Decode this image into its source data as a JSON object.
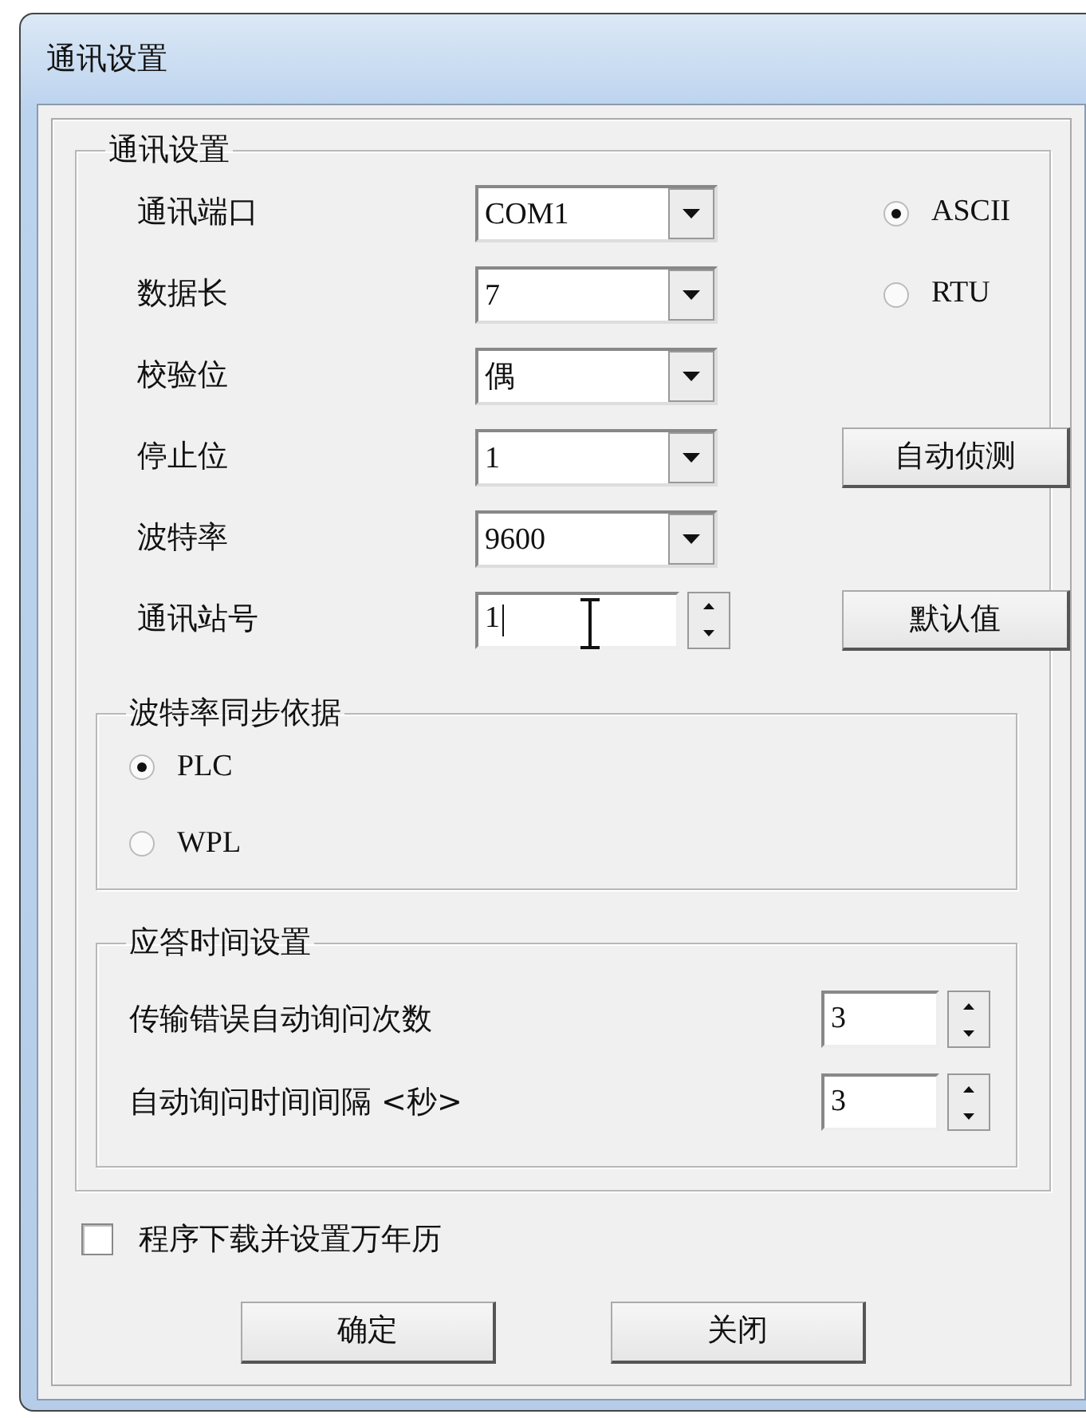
{
  "window": {
    "title": "通讯设置"
  },
  "group": {
    "title": "通讯设置",
    "fields": [
      {
        "kind": "combo",
        "label": "通讯端口",
        "value": "COM1"
      },
      {
        "kind": "combo",
        "label": "数据长",
        "value": "7"
      },
      {
        "kind": "combo",
        "label": "校验位",
        "value": "偶"
      },
      {
        "kind": "combo",
        "label": "停止位",
        "value": "1"
      },
      {
        "kind": "combo",
        "label": "波特率",
        "value": "9600"
      },
      {
        "kind": "spin",
        "label": "通讯站号",
        "value": "1"
      }
    ],
    "mode_options": [
      {
        "label": "ASCII",
        "selected": true
      },
      {
        "label": "RTU",
        "selected": false
      }
    ],
    "buttons": [
      "自动侦测",
      "默认值"
    ],
    "sync": {
      "title": "波特率同步依据",
      "options": [
        {
          "label": "PLC",
          "selected": true
        },
        {
          "label": "WPL",
          "selected": false
        }
      ]
    },
    "response": {
      "title": "应答时间设置",
      "fields": [
        {
          "label": "传输错误自动询问次数",
          "value": "3"
        },
        {
          "label": "自动询问时间间隔 <秒>",
          "value": "3"
        }
      ]
    }
  },
  "checkbox": {
    "label": "程序下载并设置万年历",
    "checked": false
  },
  "buttons": [
    "确定",
    "关闭"
  ]
}
